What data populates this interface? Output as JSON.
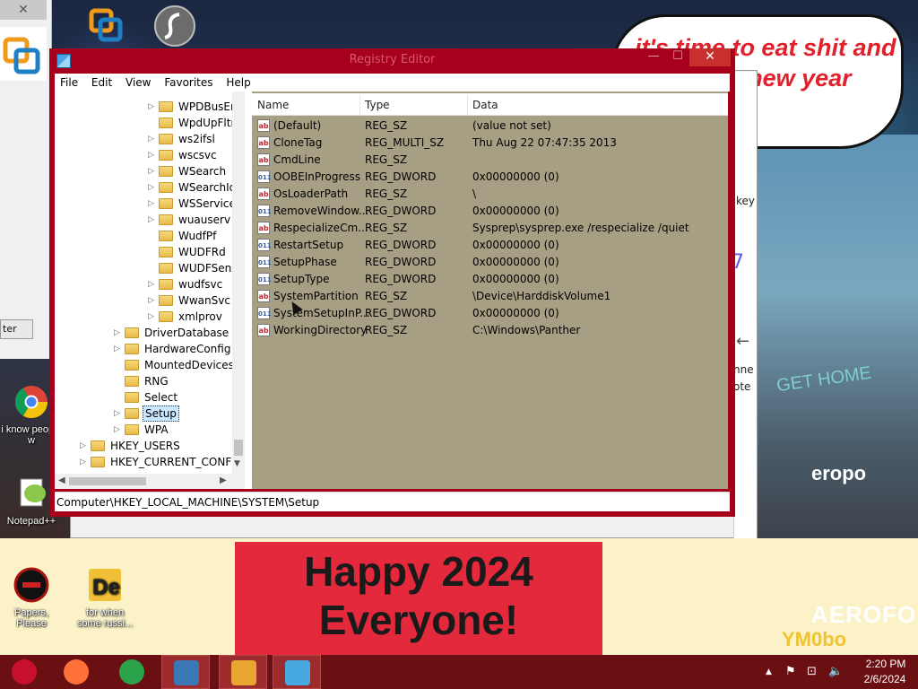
{
  "wallpaper": {
    "speech_text": "it's time to eat shit and celebrate new year",
    "banner_line1": "Happy 2024",
    "banner_line2": "Everyone!",
    "sign_text": "AEROFO",
    "sign_text2": "eropo",
    "get_home": "GET HOME",
    "wm_text": "YM0bo"
  },
  "background_window": {
    "key_fragment": "key",
    "link_fragment1": "nne",
    "link_fragment2": "ote"
  },
  "left_window": {
    "close_glyph": "✕",
    "button_fragment": "ter"
  },
  "desktop_icons": [
    {
      "label": "i know people w",
      "icon": "chrome-icon"
    },
    {
      "label": "Notepad++",
      "icon": "notepadpp-icon"
    },
    {
      "label": "Papers, Please",
      "icon": "papers-please-icon"
    },
    {
      "label": "for when some russi...",
      "icon": "de-icon"
    }
  ],
  "regedit": {
    "title": "Registry Editor",
    "minimize_glyph": "—",
    "maximize_glyph": "☐",
    "close_glyph": "✕",
    "menu": [
      "File",
      "Edit",
      "View",
      "Favorites",
      "Help"
    ],
    "tree": [
      {
        "label": "WPDBusEn",
        "level": 3,
        "expander": "▷"
      },
      {
        "label": "WpdUpFltr",
        "level": 3,
        "expander": ""
      },
      {
        "label": "ws2ifsl",
        "level": 3,
        "expander": "▷"
      },
      {
        "label": "wscsvc",
        "level": 3,
        "expander": "▷"
      },
      {
        "label": "WSearch",
        "level": 3,
        "expander": "▷"
      },
      {
        "label": "WSearchId",
        "level": 3,
        "expander": "▷"
      },
      {
        "label": "WSService",
        "level": 3,
        "expander": "▷"
      },
      {
        "label": "wuauserv",
        "level": 3,
        "expander": "▷"
      },
      {
        "label": "WudfPf",
        "level": 3,
        "expander": ""
      },
      {
        "label": "WUDFRd",
        "level": 3,
        "expander": ""
      },
      {
        "label": "WUDFSens",
        "level": 3,
        "expander": ""
      },
      {
        "label": "wudfsvc",
        "level": 3,
        "expander": "▷"
      },
      {
        "label": "WwanSvc",
        "level": 3,
        "expander": "▷"
      },
      {
        "label": "xmlprov",
        "level": 3,
        "expander": "▷"
      },
      {
        "label": "DriverDatabase",
        "level": 2,
        "expander": "▷"
      },
      {
        "label": "HardwareConfig",
        "level": 2,
        "expander": "▷"
      },
      {
        "label": "MountedDevices",
        "level": 2,
        "expander": ""
      },
      {
        "label": "RNG",
        "level": 2,
        "expander": ""
      },
      {
        "label": "Select",
        "level": 2,
        "expander": ""
      },
      {
        "label": "Setup",
        "level": 2,
        "expander": "▷",
        "selected": true
      },
      {
        "label": "WPA",
        "level": 2,
        "expander": "▷"
      },
      {
        "label": "HKEY_USERS",
        "level": 1,
        "expander": "▷"
      },
      {
        "label": "HKEY_CURRENT_CONFIG",
        "level": 1,
        "expander": "▷"
      }
    ],
    "columns": {
      "name": "Name",
      "type": "Type",
      "data": "Data"
    },
    "values": [
      {
        "name": "(Default)",
        "type": "REG_SZ",
        "data": "(value not set)",
        "kind": "sz"
      },
      {
        "name": "CloneTag",
        "type": "REG_MULTI_SZ",
        "data": "Thu Aug 22 07:47:35 2013",
        "kind": "sz"
      },
      {
        "name": "CmdLine",
        "type": "REG_SZ",
        "data": "",
        "kind": "sz"
      },
      {
        "name": "OOBEInProgress",
        "type": "REG_DWORD",
        "data": "0x00000000 (0)",
        "kind": "dw"
      },
      {
        "name": "OsLoaderPath",
        "type": "REG_SZ",
        "data": "\\",
        "kind": "sz"
      },
      {
        "name": "RemoveWindow...",
        "type": "REG_DWORD",
        "data": "0x00000000 (0)",
        "kind": "dw"
      },
      {
        "name": "RespecializeCm...",
        "type": "REG_SZ",
        "data": "Sysprep\\sysprep.exe /respecialize /quiet",
        "kind": "sz"
      },
      {
        "name": "RestartSetup",
        "type": "REG_DWORD",
        "data": "0x00000000 (0)",
        "kind": "dw"
      },
      {
        "name": "SetupPhase",
        "type": "REG_DWORD",
        "data": "0x00000000 (0)",
        "kind": "dw"
      },
      {
        "name": "SetupType",
        "type": "REG_DWORD",
        "data": "0x00000000 (0)",
        "kind": "dw"
      },
      {
        "name": "SystemPartition",
        "type": "REG_SZ",
        "data": "\\Device\\HarddiskVolume1",
        "kind": "sz"
      },
      {
        "name": "SystemSetupInP...",
        "type": "REG_DWORD",
        "data": "0x00000000 (0)",
        "kind": "dw"
      },
      {
        "name": "WorkingDirectory",
        "type": "REG_SZ",
        "data": "C:\\Windows\\Panther",
        "kind": "sz"
      }
    ],
    "icon_text": {
      "sz": "ab",
      "dw": "011"
    },
    "status_path": "Computer\\HKEY_LOCAL_MACHINE\\SYSTEM\\Setup"
  },
  "taskbar": {
    "items": [
      {
        "icon": "ladybug-start-icon",
        "color": "#c8102e"
      },
      {
        "icon": "firefox-icon",
        "color": "#ff7139"
      },
      {
        "icon": "chrome-icon",
        "color": "#2aa34a"
      },
      {
        "icon": "network-window-icon",
        "color": "#3a78b8"
      },
      {
        "icon": "vmware-icon",
        "color": "#e8a530"
      },
      {
        "icon": "regedit-icon",
        "color": "#48a8e0"
      }
    ],
    "tray": {
      "time": "2:20 PM",
      "date": "2/6/2024",
      "up_glyph": "▲",
      "flag_glyph": "⚑",
      "network_glyph": "⊡",
      "volume_glyph": "🔈"
    }
  }
}
